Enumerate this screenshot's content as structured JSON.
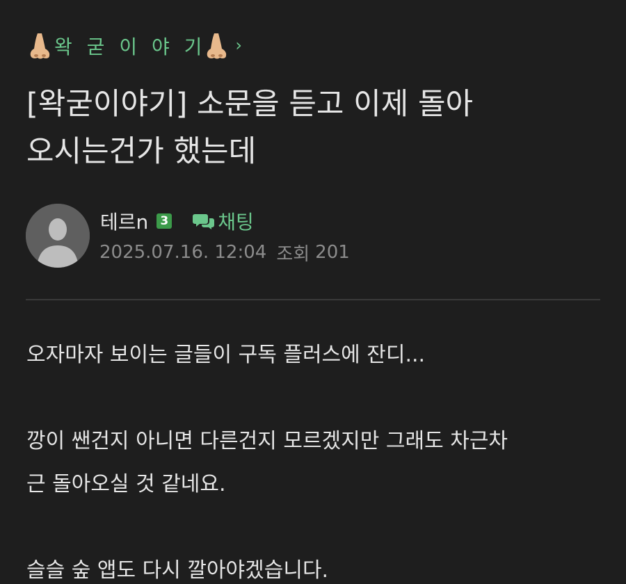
{
  "category": {
    "label": "왁 굳 이 야 기",
    "chevron": "›",
    "left_icon": "nose-emoji-icon",
    "right_icon": "nose-emoji-icon",
    "color": "#6bc78c"
  },
  "post": {
    "title_line1": "[왁굳이야기] 소문을 듣고 이제 돌아",
    "title_line2": "오시는건가 했는데",
    "author": {
      "name": "테르n",
      "level": "3",
      "avatar_icon": "default-user-avatar-icon"
    },
    "chat_label": "채팅",
    "date": "2025.07.16. 12:04",
    "views_label": "조회",
    "views": "201",
    "paragraphs": [
      "오자마자 보이는 글들이 구독 플러스에 잔디...",
      "깡이 쌘건지 아니면 다른건지 모르겠지만 그래도 차근차",
      "근 돌아오실 것 같네요.",
      "슬슬 숲 앱도 다시 깔아야겠습니다."
    ]
  },
  "colors": {
    "background": "#1e1e1e",
    "text": "#e6e6e6",
    "accent_green": "#6bc78c",
    "meta_gray": "#8c8c8c",
    "level_badge": "#3c9b4a"
  }
}
